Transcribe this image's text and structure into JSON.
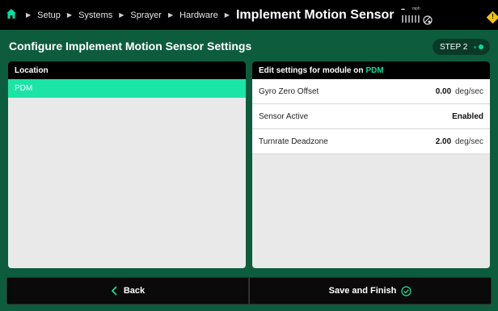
{
  "header": {
    "breadcrumbs": [
      "Setup",
      "Systems",
      "Sprayer",
      "Hardware"
    ],
    "title": "Implement Motion Sensor",
    "speed_value": "--",
    "speed_unit": "mph"
  },
  "page": {
    "heading": "Configure Implement Motion Sensor Settings",
    "step_label": "STEP 2"
  },
  "location_panel": {
    "header": "Location",
    "items": [
      "PDM"
    ]
  },
  "settings_panel": {
    "header_prefix": "Edit settings for module on",
    "header_module": "PDM",
    "rows": [
      {
        "label": "Gyro Zero Offset",
        "value": "0.00",
        "unit": "deg/sec"
      },
      {
        "label": "Sensor Active",
        "value": "Enabled",
        "unit": ""
      },
      {
        "label": "Turnrate Deadzone",
        "value": "2.00",
        "unit": "deg/sec"
      }
    ]
  },
  "footer": {
    "back_label": "Back",
    "finish_label": "Save and Finish"
  },
  "colors": {
    "background": "#0d5c3e",
    "accent": "#1be5a6",
    "warning": "#f2c500"
  },
  "icons": [
    "home-icon",
    "chevron-right-icon",
    "gps-icon",
    "warning-icon",
    "chevron-left-icon",
    "check-circle-icon"
  ]
}
